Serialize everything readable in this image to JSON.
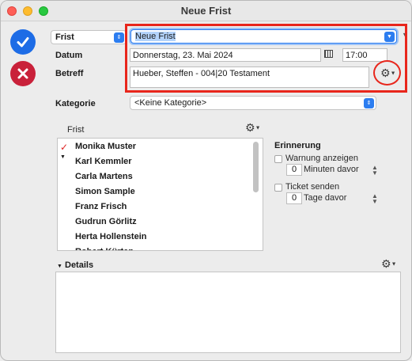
{
  "window": {
    "title": "Neue Frist"
  },
  "header": {
    "type_select": "Frist",
    "name_value": "Neue Frist",
    "datum_label": "Datum",
    "date_value": "Donnerstag, 23. Mai 2024",
    "time_value": "17:00",
    "betreff_label": "Betreff",
    "betreff_value": "Hueber, Steffen - 004|20 Testament"
  },
  "kategorie": {
    "label": "Kategorie",
    "value": "<Keine Kategorie>"
  },
  "list": {
    "header": "Frist",
    "items": [
      "Monika Muster",
      "Karl Kemmler",
      "Carla Martens",
      "Simon Sample",
      "Franz Frisch",
      "Gudrun Görlitz",
      "Herta Hollenstein",
      "Robert Kürten"
    ]
  },
  "erinnerung": {
    "title": "Erinnerung",
    "warnung_label": "Warnung anzeigen",
    "minuten_value": "0",
    "minuten_label": "Minuten davor",
    "ticket_label": "Ticket senden",
    "tage_value": "0",
    "tage_label": "Tage davor"
  },
  "details": {
    "label": "Details"
  },
  "colors": {
    "accent": "#2c7df0",
    "ok": "#1d6ce6",
    "cancel": "#c9213a",
    "highlight": "#e8261c"
  }
}
